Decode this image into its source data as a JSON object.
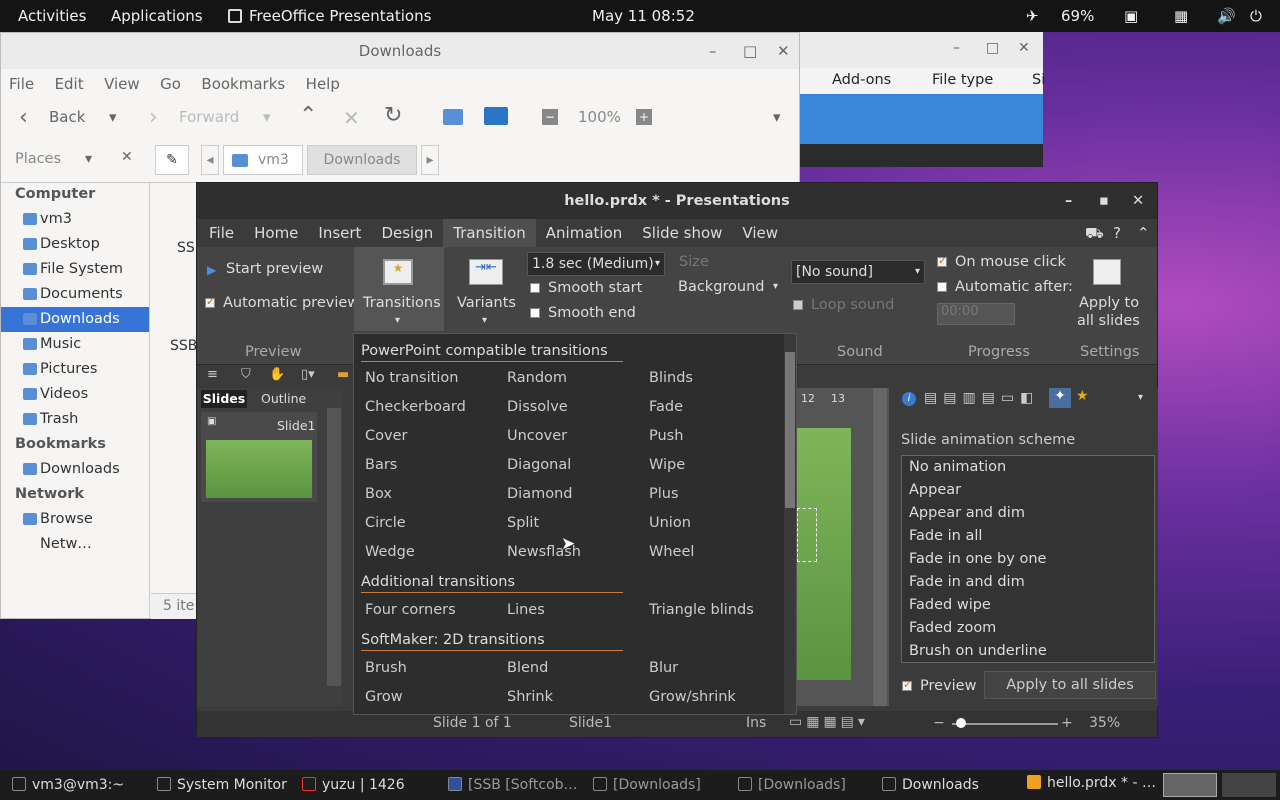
{
  "topbar": {
    "activities": "Activities",
    "applications": "Applications",
    "app_title": "FreeOffice Presentations",
    "clock": "May 11  08:52",
    "battery": "69%"
  },
  "bgwin": {
    "col_addons": "Add-ons",
    "col_filetype": "File type",
    "col_s": "Si"
  },
  "fm": {
    "title": "Downloads",
    "menu": [
      "File",
      "Edit",
      "View",
      "Go",
      "Bookmarks",
      "Help"
    ],
    "back": "Back",
    "forward": "Forward",
    "zoom": "100%",
    "places_label": "Places",
    "path": [
      "vm3",
      "Downloads"
    ],
    "sidebar": [
      {
        "label": "Computer",
        "type": "header"
      },
      {
        "label": "vm3"
      },
      {
        "label": "Desktop"
      },
      {
        "label": "File System"
      },
      {
        "label": "Documents"
      },
      {
        "label": "Downloads",
        "selected": true
      },
      {
        "label": "Music"
      },
      {
        "label": "Pictures"
      },
      {
        "label": "Videos"
      },
      {
        "label": "Trash"
      },
      {
        "label": "Bookmarks",
        "type": "header"
      },
      {
        "label": "Downloads"
      },
      {
        "label": "Network",
        "type": "header"
      },
      {
        "label": "Browse Netw…"
      }
    ],
    "file1": "SSB",
    "file2": "SSB",
    "status": "5 ite"
  },
  "pw": {
    "title": "hello.prdx * - Presentations",
    "menu": [
      "File",
      "Home",
      "Insert",
      "Design",
      "Transition",
      "Animation",
      "Slide show",
      "View"
    ],
    "start_preview": "Start preview",
    "auto_preview": "Automatic preview",
    "transitions": "Transitions",
    "variants": "Variants",
    "duration": "1.8 sec (Medium)",
    "smooth_start": "Smooth start",
    "smooth_end": "Smooth end",
    "size": "Size",
    "background": "Background",
    "sound": "[No sound]",
    "loop_sound": "Loop sound",
    "on_click": "On mouse click",
    "auto_after": "Automatic after:",
    "time": "00:00",
    "apply_all1": "Apply to",
    "apply_all2": "all slides",
    "groups": {
      "preview": "Preview",
      "sound": "Sound",
      "progress": "Progress",
      "settings": "Settings"
    },
    "tabs": {
      "slides": "Slides",
      "outline": "Outline"
    },
    "slide1": "Slide1",
    "ruler": [
      "12",
      "13"
    ],
    "anim_heading": "Slide animation scheme",
    "anim_list": [
      "No animation",
      "Appear",
      "Appear and dim",
      "Fade in all",
      "Fade in one by one",
      "Fade in and dim",
      "Faded wipe",
      "Faded zoom",
      "Brush on underline"
    ],
    "preview_chk": "Preview",
    "apply_all_slides": "Apply to all slides",
    "status": {
      "slideof": "Slide 1 of 1",
      "slidename": "Slide1",
      "ins": "Ins",
      "zoom": "35%"
    }
  },
  "transitions": {
    "sec1": "PowerPoint compatible transitions",
    "grid1": [
      [
        "No transition",
        "Random",
        "Blinds"
      ],
      [
        "Checkerboard",
        "Dissolve",
        "Fade"
      ],
      [
        "Cover",
        "Uncover",
        "Push"
      ],
      [
        "Bars",
        "Diagonal",
        "Wipe"
      ],
      [
        "Box",
        "Diamond",
        "Plus"
      ],
      [
        "Circle",
        "Split",
        "Union"
      ],
      [
        "Wedge",
        "Newsflash",
        "Wheel"
      ]
    ],
    "sec2": "Additional transitions",
    "grid2": [
      [
        "Four corners",
        "Lines",
        "Triangle blinds"
      ]
    ],
    "sec3": "SoftMaker: 2D transitions",
    "grid3": [
      [
        "Brush",
        "Blend",
        "Blur"
      ],
      [
        "Grow",
        "Shrink",
        "Grow/shrink"
      ]
    ]
  },
  "taskbar": [
    "vm3@vm3:~",
    "System Monitor",
    "yuzu | 1426",
    "[SSB [Softcob…",
    "[Downloads]",
    "[Downloads]",
    "Downloads",
    "hello.prdx * - …"
  ]
}
